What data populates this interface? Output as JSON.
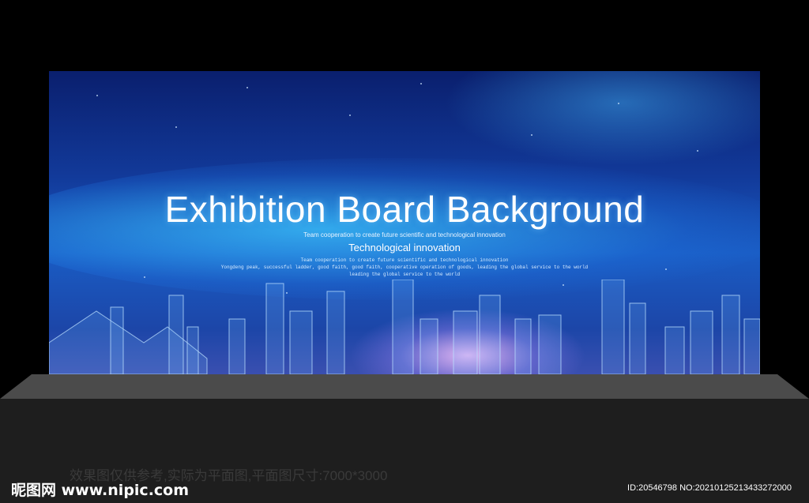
{
  "board": {
    "title": "Exhibition Board Background",
    "tagline": "Team cooperation to create future scientific and technological innovation",
    "subtitle": "Technological innovation",
    "line1": "Team cooperation to create future scientific and technological innovation",
    "line2": "Yongdeng peak, successful ladder, good faith, good faith, cooperative operation of goods, leading the global service to the world",
    "line3": "leading the global service to the world"
  },
  "footer": {
    "caption": "效果图仅供参考,实际为平面图,平面图尺寸:7000*3000",
    "logo": "昵图网 www.nipic.com",
    "id_text": "ID:20546798 NO:20210125213433272000"
  }
}
